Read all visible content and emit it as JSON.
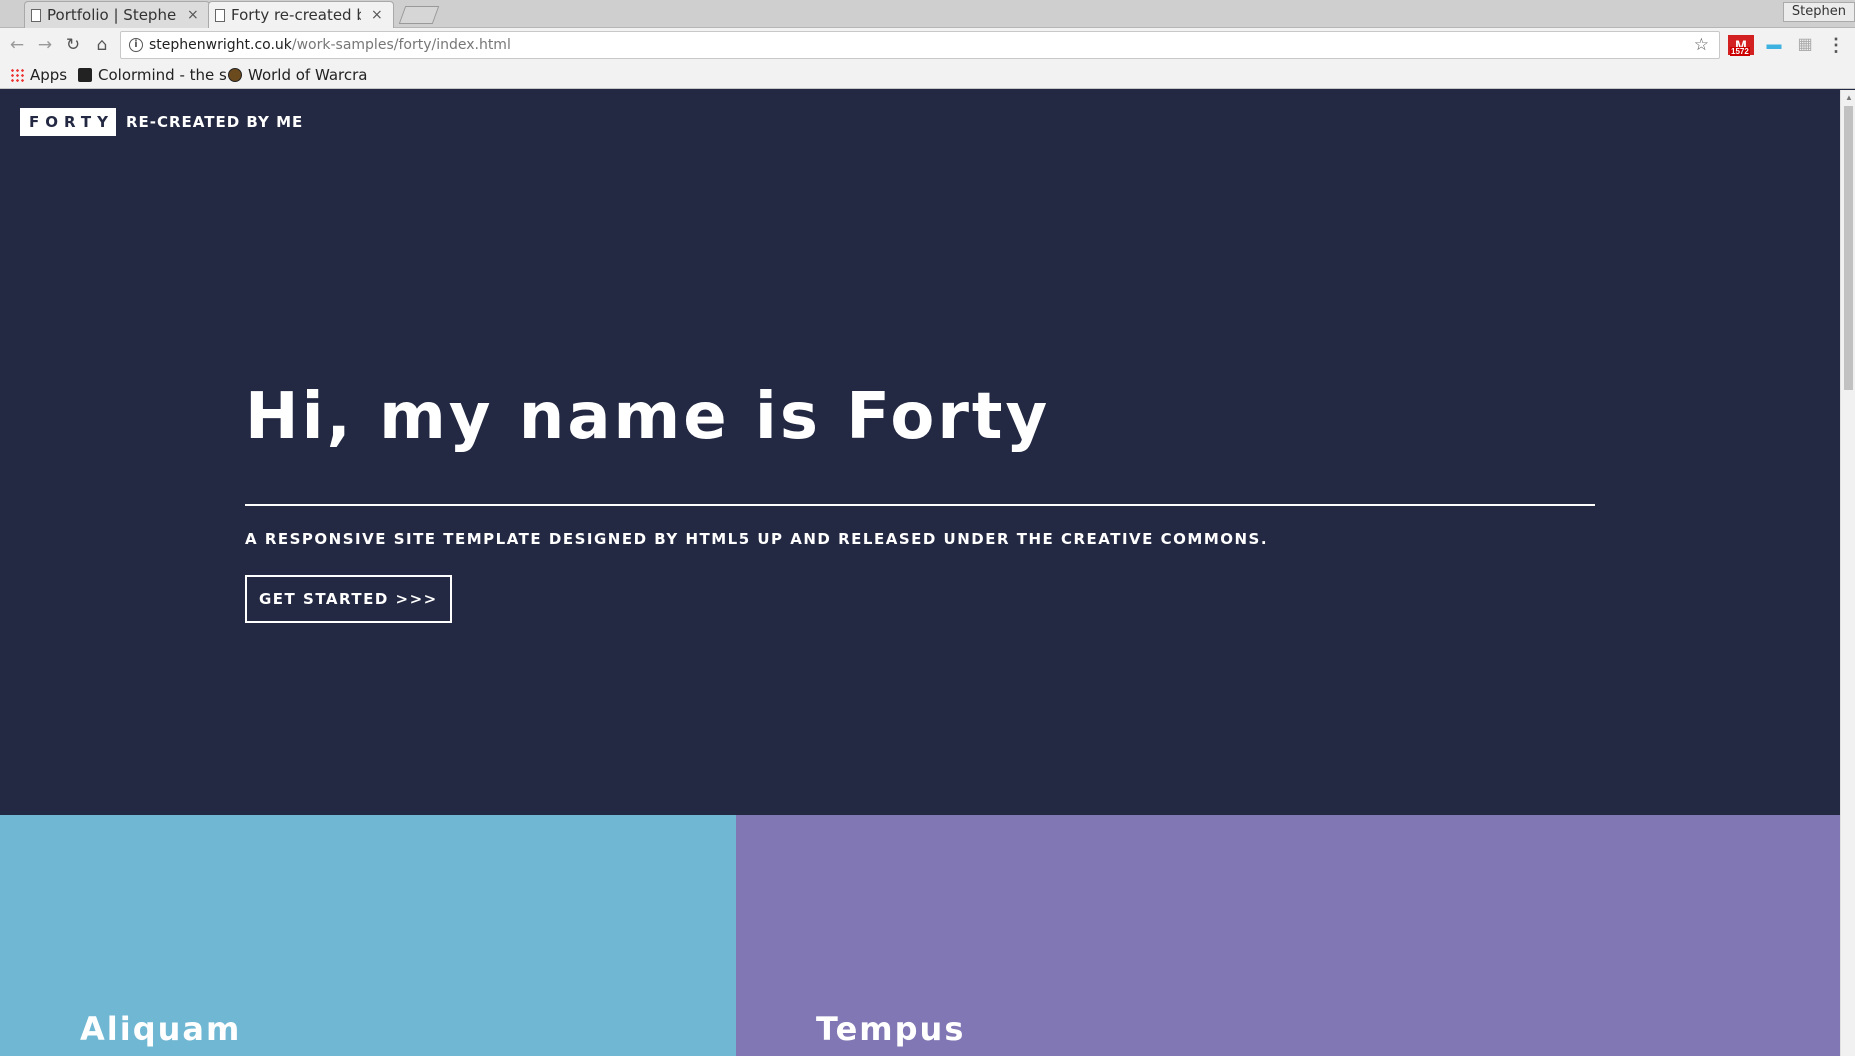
{
  "browser": {
    "tabs": [
      {
        "title": "Portfolio | Stephen",
        "active": false
      },
      {
        "title": "Forty re-created by",
        "active": true
      }
    ],
    "close_glyph": "×",
    "profile_name": "Stephen",
    "url_host": "stephenwright.co.uk",
    "url_path": "/work-samples/forty/index.html",
    "extensions": [
      {
        "name": "gmail-icon",
        "badge": "1572"
      },
      {
        "name": "chat-icon"
      },
      {
        "name": "grid-icon"
      },
      {
        "name": "menu-icon"
      }
    ],
    "bookmarks": [
      {
        "label": "Apps",
        "icon": "apps-grid-icon"
      },
      {
        "label": "Colormind - the s",
        "icon": "colormind-icon"
      },
      {
        "label": "World of Warcra",
        "icon": "wow-icon"
      }
    ]
  },
  "site": {
    "logo": "FORTY",
    "logo_sub": "RE-CREATED BY ME",
    "hero": {
      "title": "Hi, my name is Forty",
      "tagline": "A RESPONSIVE SITE TEMPLATE DESIGNED BY HTML5 UP AND RELEASED UNDER THE CREATIVE COMMONS.",
      "cta": "GET STARTED >>>"
    },
    "tiles": [
      {
        "title": "Aliquam",
        "color": "#6fb7d2"
      },
      {
        "title": "Tempus",
        "color": "#8077b4"
      }
    ],
    "colors": {
      "background": "#242943",
      "text": "#ffffff"
    }
  }
}
